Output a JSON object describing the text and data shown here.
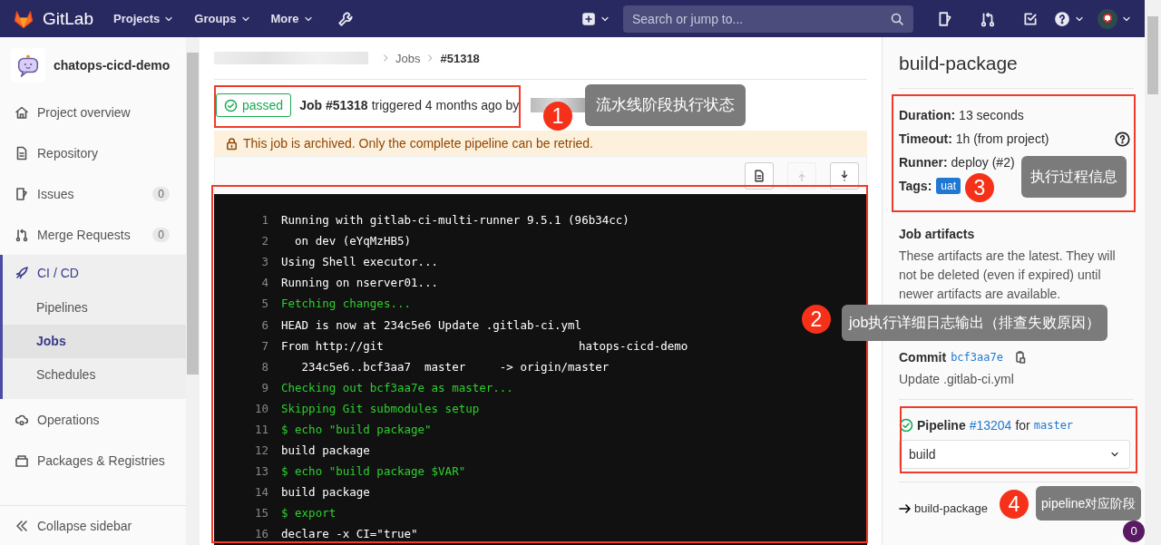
{
  "navbar": {
    "logo": "GitLab",
    "menus": [
      {
        "label": "Projects"
      },
      {
        "label": "Groups"
      },
      {
        "label": "More"
      }
    ],
    "search": {
      "placeholder": "Search or jump to..."
    }
  },
  "sidebar": {
    "project": "chatops-cicd-demo",
    "items": [
      {
        "label": "Project overview",
        "selected": false
      },
      {
        "label": "Repository",
        "selected": false
      },
      {
        "label": "Issues",
        "count": "0",
        "selected": false
      },
      {
        "label": "Merge Requests",
        "count": "0",
        "selected": false
      },
      {
        "label": "CI / CD",
        "selected": true,
        "children": [
          {
            "label": "Pipelines",
            "selected": false
          },
          {
            "label": "Jobs",
            "selected": true
          },
          {
            "label": "Schedules",
            "selected": false
          }
        ]
      },
      {
        "label": "Operations",
        "selected": false
      },
      {
        "label": "Packages & Registries",
        "selected": false
      }
    ],
    "collapse": "Collapse sidebar"
  },
  "breadcrumb": [
    "Jobs",
    "#51318"
  ],
  "job": {
    "status": "passed",
    "title": "Job #51318",
    "meta": "triggered 4 months ago by"
  },
  "notice": "This job is archived. Only the complete pipeline can be retried.",
  "toolbar": [
    {
      "disabled": false
    },
    {
      "disabled": true
    },
    {
      "disabled": false
    }
  ],
  "log": [
    {
      "number": "1",
      "parts": [
        "Running with gitlab-ci-multi-runner 9.5.1 (96b34cc)"
      ],
      "kind": "plain"
    },
    {
      "number": "2",
      "parts": [
        "  on dev (eYqMzHB5)"
      ],
      "kind": "plain"
    },
    {
      "number": "3",
      "parts": [
        "Using Shell executor..."
      ],
      "kind": "plain"
    },
    {
      "number": "4",
      "parts": [
        "Running on nserver01..."
      ],
      "kind": "plain"
    },
    {
      "number": "5",
      "parts": [
        "Fetching changes..."
      ],
      "kind": "highlight"
    },
    {
      "number": "6",
      "parts": [
        "HEAD is now at 234c5e6 Update .gitlab-ci.yml"
      ],
      "kind": "plain"
    },
    {
      "number": "7",
      "parts": [
        "From http://git",
        "hatops-cicd-demo"
      ],
      "kind": "plain"
    },
    {
      "number": "8",
      "parts": [
        "   234c5e6..bcf3aa7  master     -> origin/master"
      ],
      "kind": "plain"
    },
    {
      "number": "9",
      "parts": [
        "Checking out bcf3aa7e as master..."
      ],
      "kind": "highlight"
    },
    {
      "number": "10",
      "parts": [
        "Skipping Git submodules setup"
      ],
      "kind": "highlight"
    },
    {
      "number": "11",
      "parts": [
        "$ echo \"build package\""
      ],
      "kind": "highlight"
    },
    {
      "number": "12",
      "parts": [
        "build package"
      ],
      "kind": "plain"
    },
    {
      "number": "13",
      "parts": [
        "$ echo \"build package $VAR\""
      ],
      "kind": "highlight"
    },
    {
      "number": "14",
      "parts": [
        "build package"
      ],
      "kind": "plain"
    },
    {
      "number": "15",
      "parts": [
        "$ export"
      ],
      "kind": "highlight"
    },
    {
      "number": "16",
      "parts": [
        "declare -x CI=\"true\""
      ],
      "kind": "plain"
    }
  ],
  "details": {
    "title": "build-package",
    "info": [
      {
        "label": "Duration:",
        "value": "13 seconds",
        "help": false
      },
      {
        "label": "Timeout:",
        "value": "1h (from project)",
        "help": true
      },
      {
        "label": "Runner:",
        "value": "deploy (#2)",
        "help": false
      }
    ],
    "tags_label": "Tags:",
    "tags": [
      "uat"
    ],
    "artifacts_title": "Job artifacts",
    "artifacts_text": "These artifacts are the latest. They will not be deleted (even if expired) until newer artifacts are available.",
    "commit_label": "Commit",
    "commit_sha": "bcf3aa7e",
    "commit_message": "Update .gitlab-ci.yml",
    "pipeline_passed": true,
    "pipeline_label": "Pipeline",
    "pipeline_id": "#13204",
    "pipeline_for": "for",
    "pipeline_branch": "master",
    "stage": "build",
    "jobs": [
      {
        "name": "build-package",
        "selected": true
      }
    ]
  },
  "annotations": [
    {
      "number": "1",
      "text": "流水线阶段执行状态"
    },
    {
      "number": "3",
      "text": "执行过程信息"
    },
    {
      "number": "2",
      "text": "job执行详细日志输出（排查失败原因）"
    },
    {
      "number": "4",
      "text": "pipeline对应阶段"
    }
  ],
  "counter": "0"
}
